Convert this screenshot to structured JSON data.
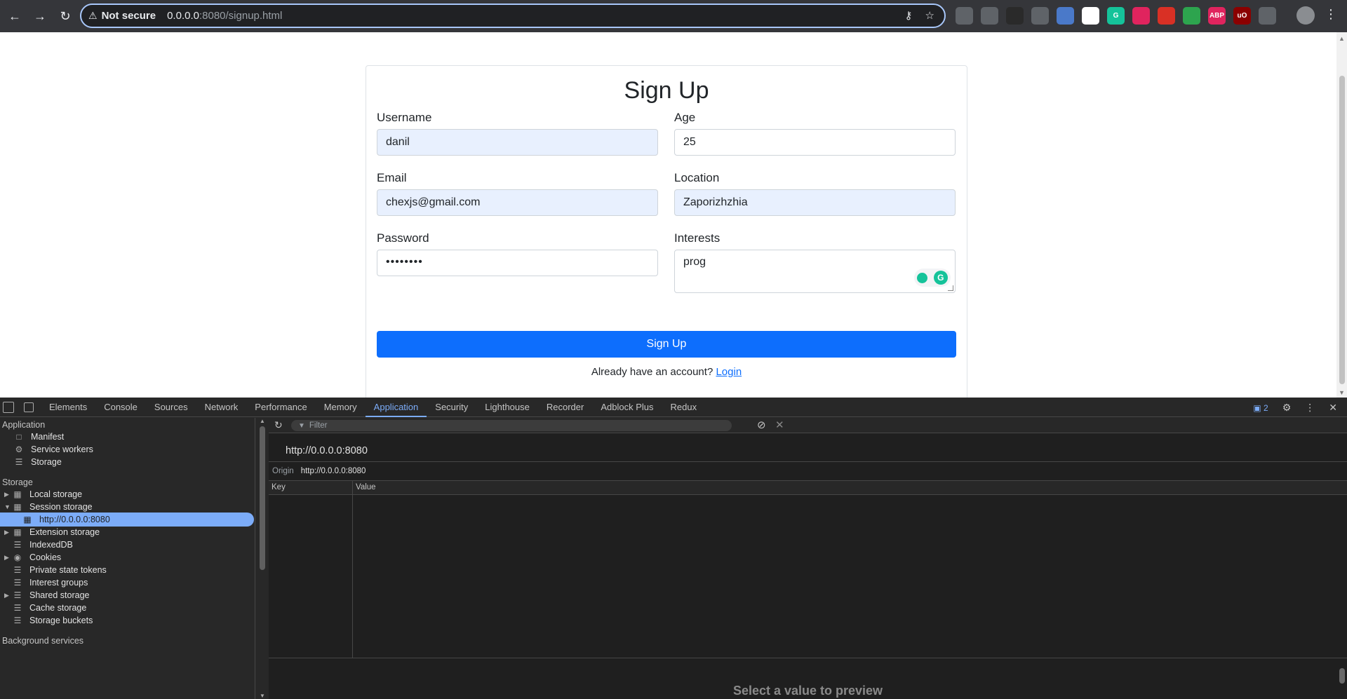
{
  "browser": {
    "not_secure": "Not secure",
    "url_host": "0.0.0.0",
    "url_path": ":8080/signup.html",
    "extensions": [
      {
        "name": "apps-icon",
        "color": "#5f6368",
        "label": ""
      },
      {
        "name": "target-icon",
        "color": "#5f6368",
        "label": ""
      },
      {
        "name": "dark-ext-icon",
        "color": "#2a2a2a",
        "label": ""
      },
      {
        "name": "camera-icon",
        "color": "#5f6368",
        "label": ""
      },
      {
        "name": "translate-icon",
        "color": "#4a79c9",
        "label": ""
      },
      {
        "name": "cube-icon",
        "color": "#ffffff",
        "label": ""
      },
      {
        "name": "grammarly-ext-icon",
        "color": "#15c39a",
        "label": "G"
      },
      {
        "name": "record-icon",
        "color": "#e0245e",
        "label": ""
      },
      {
        "name": "red-ext-icon",
        "color": "#d93025",
        "label": ""
      },
      {
        "name": "green-ext-icon",
        "color": "#2da44e",
        "label": ""
      },
      {
        "name": "adblock-icon",
        "color": "#e0245e",
        "label": "ABP"
      },
      {
        "name": "ublock-icon",
        "color": "#8b0000",
        "label": "uO"
      },
      {
        "name": "puzzle-icon",
        "color": "#5f6368",
        "label": ""
      }
    ]
  },
  "page": {
    "title": "Sign Up",
    "username_label": "Username",
    "username_value": "danil",
    "age_label": "Age",
    "age_value": "25",
    "email_label": "Email",
    "email_value": "chexjs@gmail.com",
    "location_label": "Location",
    "location_value": "Zaporizhzhia",
    "password_label": "Password",
    "password_value": "••••••••",
    "interests_label": "Interests",
    "interests_value": "prog",
    "submit_label": "Sign Up",
    "already_text": "Already have an account?",
    "login_link": "Login"
  },
  "devtools": {
    "tabs": [
      "Elements",
      "Console",
      "Sources",
      "Network",
      "Performance",
      "Memory",
      "Application",
      "Security",
      "Lighthouse",
      "Recorder",
      "Adblock Plus",
      "Redux"
    ],
    "active_tab": "Application",
    "issues_count": "2",
    "sidebar": {
      "application_header": "Application",
      "application_items": [
        "Manifest",
        "Service workers",
        "Storage"
      ],
      "storage_header": "Storage",
      "storage_items": [
        "Local storage",
        "Session storage",
        "http://0.0.0.0:8080",
        "Extension storage",
        "IndexedDB",
        "Cookies",
        "Private state tokens",
        "Interest groups",
        "Shared storage",
        "Cache storage",
        "Storage buckets"
      ],
      "background_header": "Background services"
    },
    "main": {
      "filter_placeholder": "Filter",
      "origin_title": "http://0.0.0.0:8080",
      "origin_label": "Origin",
      "origin_value": "http://0.0.0.0:8080",
      "key_header": "Key",
      "value_header": "Value",
      "preview_text": "Select a value to preview"
    }
  }
}
